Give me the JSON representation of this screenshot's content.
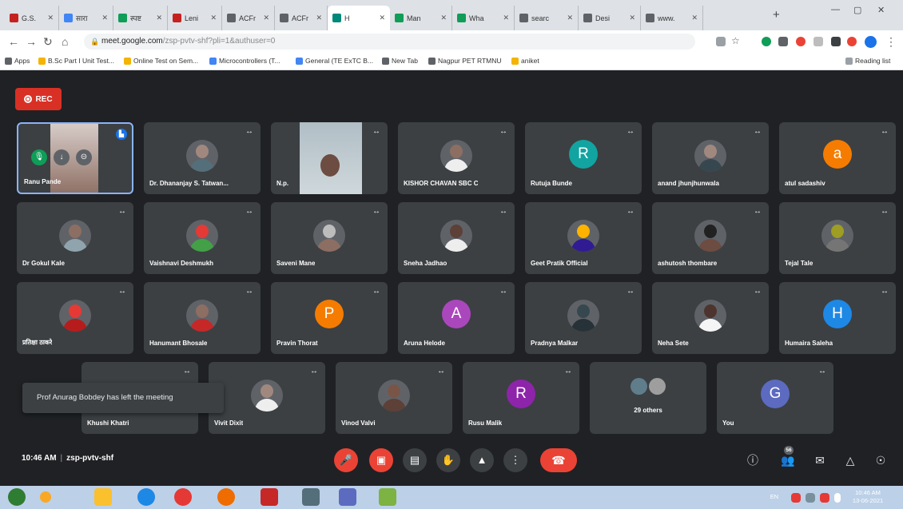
{
  "browser": {
    "tabs": [
      {
        "label": "G.S.",
        "color": "#c5221f"
      },
      {
        "label": "सारा",
        "color": "#4285f4"
      },
      {
        "label": "स्पष्ट",
        "color": "#0f9d58"
      },
      {
        "label": "Leni",
        "color": "#c5221f"
      },
      {
        "label": "ACFr",
        "color": "#5f6368"
      },
      {
        "label": "ACFr",
        "color": "#5f6368"
      },
      {
        "label": "H",
        "color": "#00897b",
        "active": true
      },
      {
        "label": "Man",
        "color": "#0f9d58"
      },
      {
        "label": "Wha",
        "color": "#0f9d58"
      },
      {
        "label": "searc",
        "color": "#5f6368"
      },
      {
        "label": "Desi",
        "color": "#5f6368"
      },
      {
        "label": "www.",
        "color": "#5f6368"
      }
    ],
    "url_host": "meet.google.com",
    "url_path": "/zsp-pvtv-shf?pli=1&authuser=0",
    "bookmarks": [
      {
        "label": "Apps",
        "color": "#5f6368"
      },
      {
        "label": "B.Sc Part I Unit Test...",
        "color": "#f4b400"
      },
      {
        "label": "Online Test on Sem...",
        "color": "#f4b400"
      },
      {
        "label": "Microcontrollers (T...",
        "color": "#4285f4"
      },
      {
        "label": "General (TE ExTC B...",
        "color": "#4285f4"
      },
      {
        "label": "New Tab",
        "color": "#5f6368"
      },
      {
        "label": "Nagpur PET RTMNU",
        "color": "#5f6368"
      },
      {
        "label": "aniket",
        "color": "#f4b400"
      }
    ],
    "reading_list": "Reading list"
  },
  "meet": {
    "rec_label": "REC",
    "tiles": [
      {
        "name": "Ranu Pande",
        "kind": "self"
      },
      {
        "name": "Dr. Dhananjay S. Tatwan...",
        "kind": "photo",
        "head": "#a1887f",
        "body": "#546e7a"
      },
      {
        "name": "N.p.",
        "kind": "video"
      },
      {
        "name": "KISHOR CHAVAN SBC C",
        "kind": "photo",
        "head": "#8d6e63",
        "body": "#eeeeee"
      },
      {
        "name": "Rutuja Bunde",
        "kind": "letter",
        "letter": "R",
        "color": "#12a4a0"
      },
      {
        "name": "anand jhunjhunwala",
        "kind": "photo",
        "head": "#a1887f",
        "body": "#37474f"
      },
      {
        "name": "atul sadashiv",
        "kind": "letter",
        "letter": "a",
        "color": "#f57c00"
      },
      {
        "name": "Dr Gokul Kale",
        "kind": "photo",
        "head": "#8d6e63",
        "body": "#90a4ae"
      },
      {
        "name": "Vaishnavi Deshmukh",
        "kind": "photo",
        "head": "#e53935",
        "body": "#43a047"
      },
      {
        "name": "Saveni Mane",
        "kind": "photo",
        "head": "#bdbdbd",
        "body": "#8d6e63"
      },
      {
        "name": "Sneha Jadhao",
        "kind": "photo",
        "head": "#5d4037",
        "body": "#eeeeee"
      },
      {
        "name": "Geet Pratik Official",
        "kind": "photo",
        "head": "#ffb300",
        "body": "#311b92"
      },
      {
        "name": "ashutosh thombare",
        "kind": "photo",
        "head": "#212121",
        "body": "#6d4c41"
      },
      {
        "name": "Tejal Tale",
        "kind": "photo",
        "head": "#9e9d24",
        "body": "#757575"
      },
      {
        "name": "प्रतिक्षा ठाकरे",
        "kind": "photo",
        "head": "#e53935",
        "body": "#b71c1c"
      },
      {
        "name": "Hanumant Bhosale",
        "kind": "photo",
        "head": "#8d6e63",
        "body": "#c62828"
      },
      {
        "name": "Pravin Thorat",
        "kind": "letter",
        "letter": "P",
        "color": "#f57c00"
      },
      {
        "name": "Aruna Helode",
        "kind": "letter",
        "letter": "A",
        "color": "#ab47bc"
      },
      {
        "name": "Pradnya Malkar",
        "kind": "photo",
        "head": "#37474f",
        "body": "#263238"
      },
      {
        "name": "Neha Sete",
        "kind": "photo",
        "head": "#4e342e",
        "body": "#f5f5f5"
      },
      {
        "name": "Humaira Saleha",
        "kind": "letter",
        "letter": "H",
        "color": "#1e88e5"
      },
      {
        "name": "Khushi Khatri",
        "kind": "empty"
      },
      {
        "name": "Vivit Dixit",
        "kind": "photo",
        "head": "#a1887f",
        "body": "#eeeeee"
      },
      {
        "name": "Vinod Valvi",
        "kind": "photo",
        "head": "#795548",
        "body": "#5d4037"
      },
      {
        "name": "Rusu Malik",
        "kind": "letter",
        "letter": "R",
        "color": "#8e24aa"
      },
      {
        "name": "29 others",
        "kind": "others"
      },
      {
        "name": "You",
        "kind": "letter",
        "letter": "G",
        "color": "#5c6bc0"
      }
    ],
    "toast": "Prof Anurag Bobdey has left the meeting",
    "time": "10:46 AM",
    "meeting_code": "zsp-pvtv-shf",
    "participant_count": "56"
  },
  "taskbar": {
    "tray_lang": "EN",
    "tray_time": "10:46 AM",
    "tray_date": "13-06-2021"
  }
}
